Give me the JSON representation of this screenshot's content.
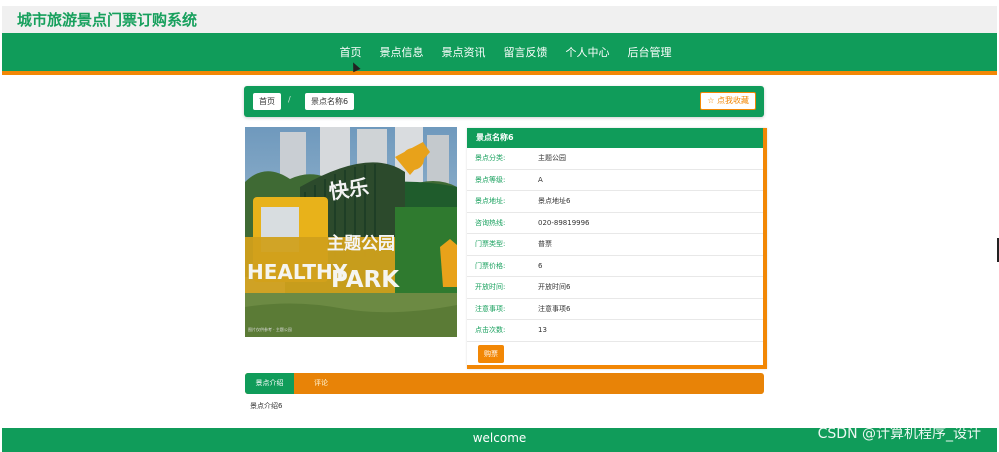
{
  "site": {
    "title": "城市旅游景点门票订购系统"
  },
  "nav": [
    "首页",
    "景点信息",
    "景点资讯",
    "留言反馈",
    "个人中心",
    "后台管理"
  ],
  "breadcrumb": {
    "home": "首页",
    "separator": "/",
    "current": "景点名称6"
  },
  "favorite_button": "☆ 点我收藏",
  "photo": {
    "sign_top": "快乐",
    "sign_main": "主题公园",
    "sign_left": "HEALTHY",
    "sign_right": "PARK",
    "caption": "图片仅供参考 · 主题公园"
  },
  "info": {
    "title": "景点名称6",
    "rows": [
      {
        "label": "景点分类:",
        "value": "主题公园"
      },
      {
        "label": "景点等级:",
        "value": "A"
      },
      {
        "label": "景点地址:",
        "value": "景点地址6"
      },
      {
        "label": "咨询热线:",
        "value": "020-89819996"
      },
      {
        "label": "门票类型:",
        "value": "普票"
      },
      {
        "label": "门票价格:",
        "value": "6"
      },
      {
        "label": "开放时间:",
        "value": "开放时间6"
      },
      {
        "label": "注意事项:",
        "value": "注意事项6"
      },
      {
        "label": "点击次数:",
        "value": "13"
      }
    ],
    "buy_button": "购票"
  },
  "tabs": [
    "景点介绍",
    "评论"
  ],
  "tab_content": "景点介绍6",
  "footer": "welcome",
  "watermark": "CSDN @计算机程序_设计",
  "colors": {
    "primary_green": "#109c5a",
    "accent_orange": "#f28705"
  }
}
